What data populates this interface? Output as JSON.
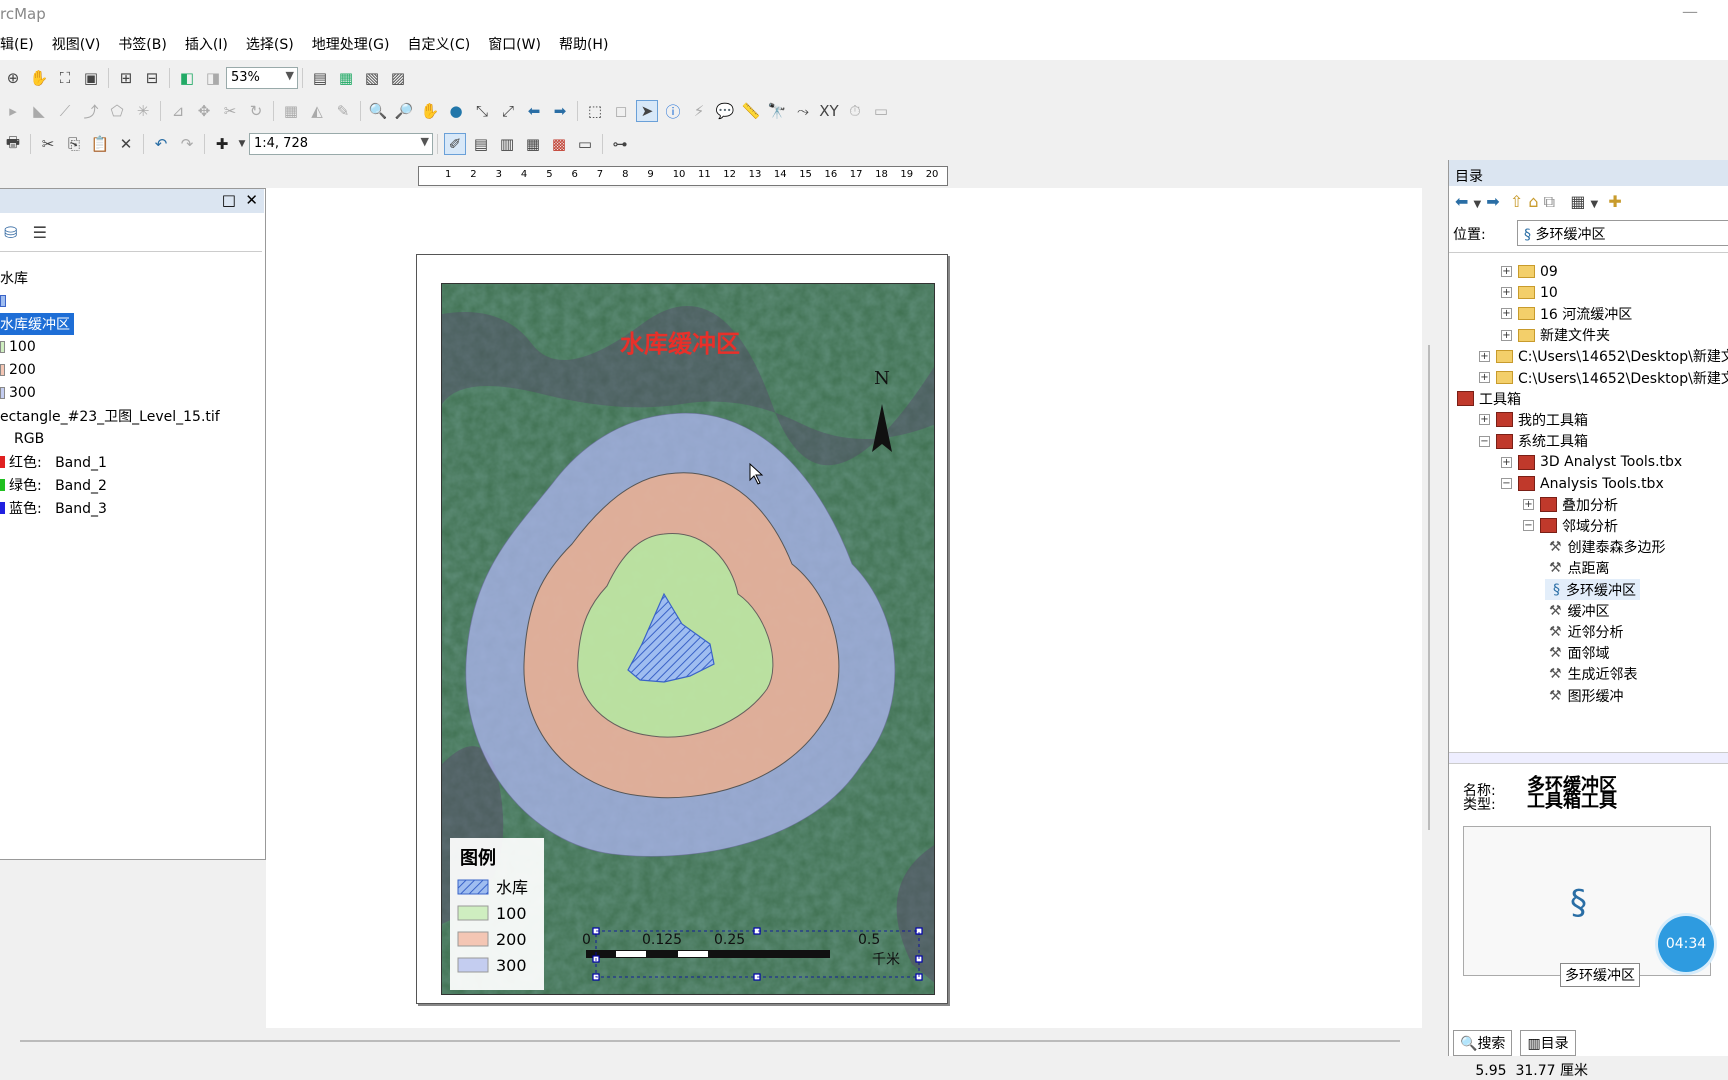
{
  "app": {
    "title": "rcMap"
  },
  "menu": [
    "辑(E)",
    "视图(V)",
    "书签(B)",
    "插入(I)",
    "选择(S)",
    "地理处理(G)",
    "自定义(C)",
    "窗口(W)",
    "帮助(H)"
  ],
  "toolbar": {
    "zoom_level": "53%",
    "scale": "1:4, 728"
  },
  "toc": {
    "rows": [
      "水库",
      "水库缓冲区",
      "100",
      "200",
      "300",
      "ectangle_#23_卫图_Level_15.tif",
      "RGB",
      "红色:   Band_1",
      "绿色:   Band_2",
      "蓝色:   Band_3"
    ]
  },
  "ruler": {
    "ticks": [
      "1",
      "2",
      "3",
      "4",
      "5",
      "6",
      "7",
      "8",
      "9",
      "10",
      "11",
      "12",
      "13",
      "14",
      "15",
      "16",
      "17",
      "18",
      "19",
      "20"
    ]
  },
  "map": {
    "title": "水库缓冲区",
    "north_label": "N",
    "legend_title": "图例",
    "legend": [
      {
        "label": "水库",
        "color": "#8fb0e8"
      },
      {
        "label": "100",
        "color": "#cfeec0"
      },
      {
        "label": "200",
        "color": "#f4c6b4"
      },
      {
        "label": "300",
        "color": "#c4cdf0"
      }
    ],
    "scalebar": {
      "labels": [
        "0",
        "0.125",
        "0.25",
        "0.5"
      ],
      "unit": "千米"
    },
    "colors": {
      "ring300": "#aab4ec",
      "ring200": "#eeb08e",
      "ring100": "#b6e8a2",
      "reservoir": "#7ea6e8"
    }
  },
  "catalog": {
    "title": "目录",
    "location_label": "位置:",
    "location_value": "多环缓冲区",
    "tree": [
      {
        "label": "09",
        "type": "folder",
        "level": 1,
        "pm": "+"
      },
      {
        "label": "10",
        "type": "folder",
        "level": 1,
        "pm": "+"
      },
      {
        "label": "16 河流缓冲区",
        "type": "folder",
        "level": 1,
        "pm": "+"
      },
      {
        "label": "新建文件夹",
        "type": "folder",
        "level": 1,
        "pm": "+"
      },
      {
        "label": "C:\\Users\\14652\\Desktop\\新建文",
        "type": "folder",
        "level": 0,
        "pm": "+"
      },
      {
        "label": "C:\\Users\\14652\\Desktop\\新建文",
        "type": "folder",
        "level": 0,
        "pm": "+"
      },
      {
        "label": "工具箱",
        "type": "toolbox",
        "level": -1,
        "pm": ""
      },
      {
        "label": "我的工具箱",
        "type": "toolbox",
        "level": 0,
        "pm": "+"
      },
      {
        "label": "系统工具箱",
        "type": "toolbox",
        "level": 0,
        "pm": "−"
      },
      {
        "label": "3D Analyst Tools.tbx",
        "type": "toolbox",
        "level": 1,
        "pm": "+"
      },
      {
        "label": "Analysis Tools.tbx",
        "type": "toolbox",
        "level": 1,
        "pm": "−"
      },
      {
        "label": "叠加分析",
        "type": "toolset",
        "level": 2,
        "pm": "+"
      },
      {
        "label": "邻域分析",
        "type": "toolset",
        "level": 2,
        "pm": "−"
      },
      {
        "label": "创建泰森多边形",
        "type": "tool",
        "level": 3,
        "pm": ""
      },
      {
        "label": "点距离",
        "type": "tool",
        "level": 3,
        "pm": ""
      },
      {
        "label": "多环缓冲区",
        "type": "script",
        "level": 3,
        "pm": ""
      },
      {
        "label": "缓冲区",
        "type": "tool",
        "level": 3,
        "pm": ""
      },
      {
        "label": "近邻分析",
        "type": "tool",
        "level": 3,
        "pm": ""
      },
      {
        "label": "面邻域",
        "type": "tool",
        "level": 3,
        "pm": ""
      },
      {
        "label": "生成近邻表",
        "type": "tool",
        "level": 3,
        "pm": ""
      },
      {
        "label": "图形缓冲",
        "type": "tool",
        "level": 3,
        "pm": ""
      }
    ],
    "info": {
      "name_label": "名称:",
      "type_label": "类型:",
      "name_value": "多环缓冲区",
      "type_value": "工具箱工具",
      "preview_caption": "多环缓冲区"
    },
    "tabs": [
      "搜索",
      "目录"
    ]
  },
  "timer": "04:34",
  "status": {
    "coords": "5.95  31.77 厘米"
  }
}
